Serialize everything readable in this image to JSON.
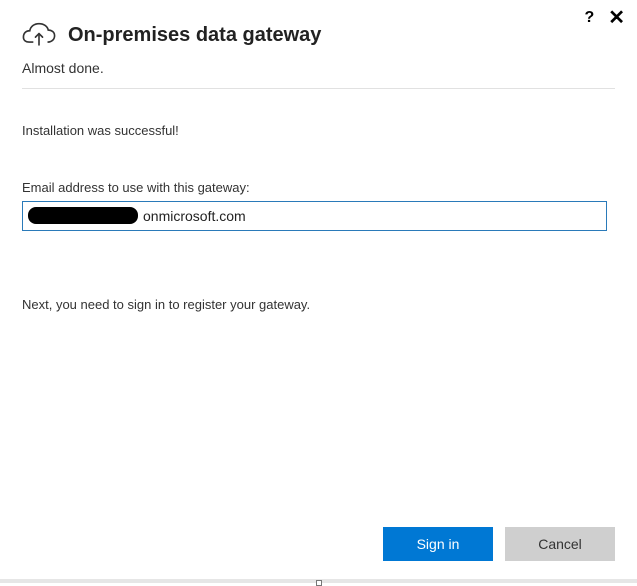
{
  "titlebar": {
    "help_glyph": "?",
    "close_glyph": "✕"
  },
  "header": {
    "title": "On-premises data gateway",
    "subtitle": "Almost done."
  },
  "content": {
    "status": "Installation was successful!",
    "email_label": "Email address to use with this gateway:",
    "email_value": "onmicrosoft.com",
    "next_instruction": "Next, you need to sign in to register your gateway."
  },
  "footer": {
    "primary_label": "Sign in",
    "secondary_label": "Cancel"
  }
}
